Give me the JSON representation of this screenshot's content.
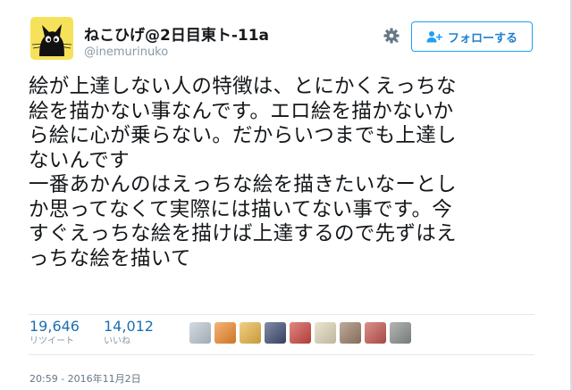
{
  "user": {
    "display_name": "ねこひげ@2日目東ト-11a",
    "screen_name": "@inemurinuko"
  },
  "actions": {
    "settings_icon": "gear-icon",
    "follow_icon": "person-plus-icon",
    "follow_label": "フォローする"
  },
  "tweet": {
    "lines": [
      "絵が上達しない人の特徴は、とにかくえっちな",
      "絵を描かない事なんです。エロ絵を描かないか",
      "ら絵に心が乗らない。だからいつまでも上達し",
      "ないんです",
      "一番あかんのはえっちな絵を描きたいなーとし",
      "か思ってなくて実際には描いてない事です。今",
      "すぐえっちな絵を描けば上達するので先ずはえ",
      "っちな絵を描いて"
    ]
  },
  "stats": {
    "retweets": {
      "count": "19,646",
      "label": "リツイート"
    },
    "likes": {
      "count": "14,012",
      "label": "いいね"
    }
  },
  "liked_by": [
    {
      "name": "liker-avatar-1",
      "color": "#bcc8d2"
    },
    {
      "name": "liker-avatar-2",
      "color": "#f08a2c"
    },
    {
      "name": "liker-avatar-3",
      "color": "#e9b544"
    },
    {
      "name": "liker-avatar-4",
      "color": "#3f4d74"
    },
    {
      "name": "liker-avatar-5",
      "color": "#cf4740"
    },
    {
      "name": "liker-avatar-6",
      "color": "#e0d7b8"
    },
    {
      "name": "liker-avatar-7",
      "color": "#9a7e68"
    },
    {
      "name": "liker-avatar-8",
      "color": "#c5554e"
    },
    {
      "name": "liker-avatar-9",
      "color": "#8a8f8e"
    }
  ],
  "timestamp": "20:59 - 2016年11月2日",
  "colors": {
    "accent": "#1da1f2",
    "link_number": "#1d6fb0",
    "muted": "#8899a6",
    "avatar_bg": "#f6e25a"
  }
}
